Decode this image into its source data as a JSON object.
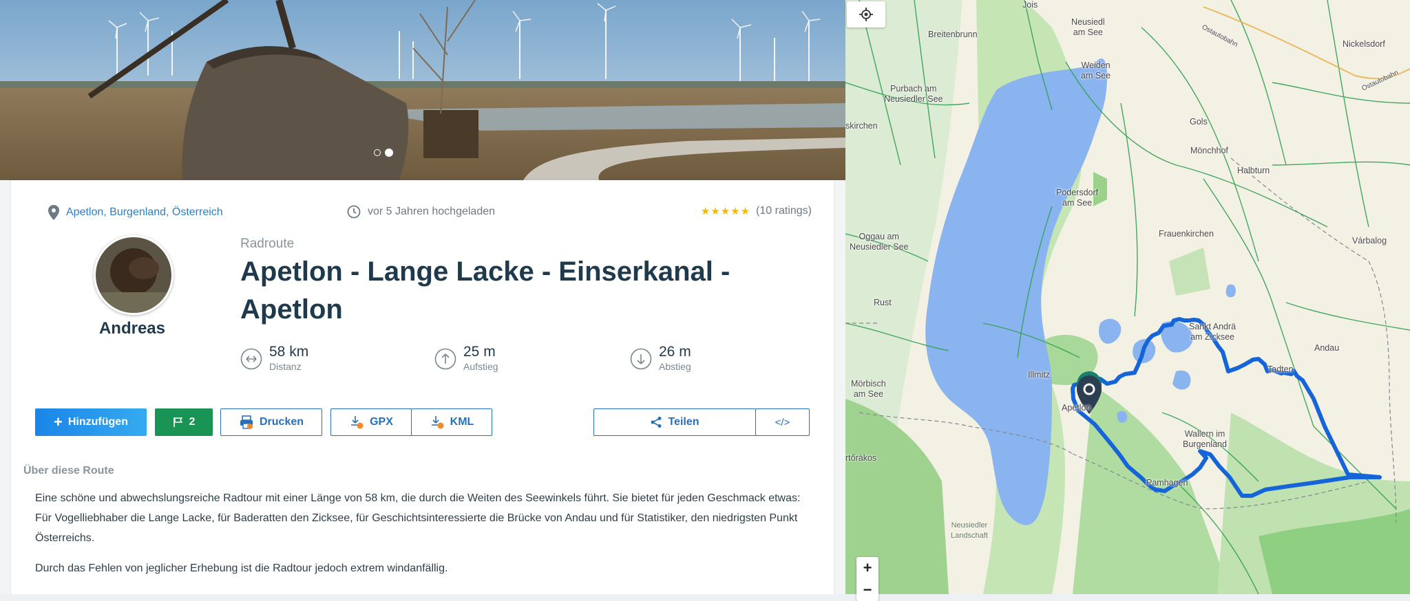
{
  "hero": {
    "slides": 2,
    "active_slide": 2
  },
  "meta": {
    "location": "Apetlon, Burgenland, Österreich",
    "uploaded": "vor 5 Jahren hochgeladen",
    "stars": "★★★★★",
    "rating_count": "(10 ratings)"
  },
  "author": {
    "name": "Andreas"
  },
  "route": {
    "kind": "Radroute",
    "title": "Apetlon - Lange Lacke - Einserkanal - Apetlon"
  },
  "stats": [
    {
      "value": "58 km",
      "label": "Distanz",
      "icon": "distance-icon"
    },
    {
      "value": "25 m",
      "label": "Aufstieg",
      "icon": "ascent-icon"
    },
    {
      "value": "26 m",
      "label": "Abstieg",
      "icon": "descent-icon"
    }
  ],
  "buttons": {
    "add": "Hinzufügen",
    "flag_count": "2",
    "print": "Drucken",
    "gpx": "GPX",
    "kml": "KML",
    "share": "Teilen",
    "embed": "</>"
  },
  "about": {
    "heading": "Über diese Route",
    "paragraphs": [
      "Eine schöne und abwechslungsreiche Radtour mit einer Länge von 58 km, die durch die Weiten des Seewinkels führt. Sie bietet für jeden Geschmack etwas: Für Vogelliebhaber die Lange Lacke, für Baderatten den Zicksee, für Geschichtsinteressierte die Brücke von Andau und für Statistiker, den niedrigsten Punkt Österreichs.",
      "Durch das Fehlen von jeglicher Erhebung ist die Radtour jedoch extrem windanfällig."
    ]
  },
  "map": {
    "zoom_in": "+",
    "zoom_out": "−",
    "labels": {
      "jois": "Jois",
      "neusiedl": "Neusiedl\nam See",
      "breitenbrunn": "Breitenbrunn",
      "weiden": "Weiden\nam See",
      "ostautobahn1": "Ostautobahn",
      "nickelsdorf": "Nickelsdorf",
      "ostautobahn2": "Ostautobahn",
      "purbach": "Purbach am\nNeusiedler See",
      "gols": "Gols",
      "kirchen": "skirchen",
      "moenchhof": "Mönchhof",
      "halbturn": "Halbturn",
      "podersdorf": "Podersdorf\nam See",
      "frauenkirchen": "Frauenkirchen",
      "oggau": "Oggau am\nNeusiedler See",
      "varbalog": "Várbalog",
      "rust": "Rust",
      "sankt_andrae": "Sankt Andrä\nam Zicksee",
      "andau": "Andau",
      "tadten": "Tadten",
      "illmitz": "Illmitz",
      "moerbisch": "Mörbisch\nam See",
      "apetlon": "Apetlon",
      "wallern": "Wallern im\nBurgenland",
      "fertorakos": "rtőrákos",
      "pamhagen": "Pamhagen",
      "neusiedler_landschaft": "Neusiedler\nLandschaft"
    }
  },
  "colors": {
    "accent_blue": "#1c8be6",
    "flag_green": "#1a9455",
    "outline_blue": "#2670b8",
    "route_blue": "#1565d8",
    "lake_blue": "#8ab4f0",
    "star_gold": "#f6b800"
  }
}
